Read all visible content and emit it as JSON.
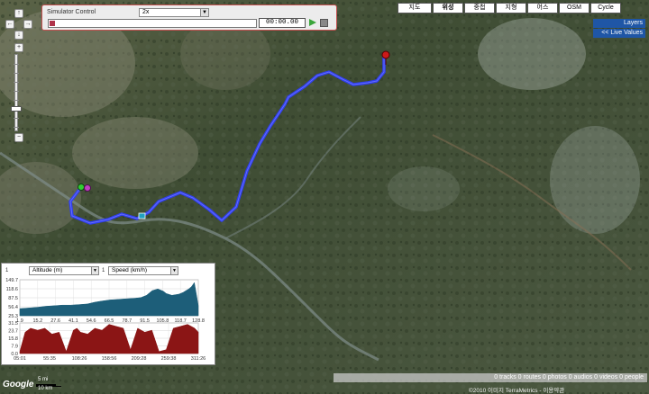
{
  "simulator": {
    "title": "Simulator Control",
    "speed": "2x",
    "time": "00:00.00"
  },
  "map_types": [
    "지도",
    "위성",
    "중첩",
    "지형",
    "어스",
    "OSM",
    "Cycle"
  ],
  "map_type_active": "위성",
  "layers_label": "Layers",
  "live_values_label": "<< Live Values",
  "nav_icons": [
    "pan-up-icon",
    "pan-left-icon",
    "pan-right-icon",
    "pan-down-icon",
    "zoom-in-icon",
    "zoom-out-icon"
  ],
  "chart_panel": {
    "left_select": "Altitude (m)",
    "right_select": "Speed (km/h)",
    "left_prefix": "1",
    "right_prefix": "1"
  },
  "status_bar": "0 tracks 0 routes 0 photos 0 audios 0 videos 0 people",
  "copyright": "©2010 이미지 TerraMetrics - 이용약관",
  "scale": {
    "top": "5 mi",
    "bottom": "10 km"
  },
  "logo": "Google",
  "colors": {
    "track": "#2f3ef0",
    "altitude_fill": "#1d5e79",
    "speed_fill": "#8b1515",
    "layers_bg": "#1f56a6"
  },
  "chart_data": [
    {
      "type": "area",
      "title": "",
      "ylabel": "Altitude (m)",
      "yticks": [
        "149.7",
        "118.6",
        "87.5",
        "56.4",
        "25.3"
      ],
      "xticks": [
        "1.9",
        "15.2",
        "27.6",
        "41.1",
        "54.6",
        "66.5",
        "78.7",
        "91.5",
        "105.8",
        "118.7",
        "128.8"
      ],
      "xlim": [
        1.9,
        128.8
      ],
      "ylim": [
        25.3,
        149.7
      ],
      "x": [
        1.9,
        8,
        15,
        20,
        27,
        32,
        38,
        44,
        50,
        55,
        60,
        66,
        72,
        78,
        84,
        88,
        92,
        96,
        100,
        104,
        106,
        110,
        115,
        118,
        120,
        122,
        124,
        126,
        128.8
      ],
      "y": [
        50,
        52,
        55,
        58,
        60,
        62,
        62,
        64,
        66,
        72,
        76,
        80,
        82,
        84,
        86,
        88,
        96,
        112,
        118,
        110,
        102,
        96,
        100,
        106,
        112,
        118,
        126,
        140,
        60
      ],
      "color": "#1d5e79"
    },
    {
      "type": "area",
      "title": "",
      "ylabel": "Speed (km/h)",
      "yticks": [
        "31.5",
        "23.7",
        "15.8",
        "7.9",
        "0.0"
      ],
      "xticks": [
        "05:01",
        "55:35",
        "108:26",
        "158:56",
        "209:28",
        "259:38",
        "311:26"
      ],
      "ylim": [
        0,
        31.5
      ],
      "x": [
        0,
        3,
        6,
        10,
        14,
        18,
        22,
        26,
        30,
        32,
        34,
        38,
        42,
        46,
        50,
        54,
        58,
        62,
        66,
        70,
        74,
        78,
        82,
        86,
        90,
        94,
        98,
        100
      ],
      "y": [
        2,
        22,
        26,
        24,
        26,
        20,
        22,
        2,
        24,
        26,
        22,
        20,
        26,
        24,
        30,
        28,
        26,
        4,
        26,
        22,
        24,
        2,
        4,
        26,
        28,
        30,
        26,
        22
      ],
      "color": "#8b1515"
    }
  ]
}
